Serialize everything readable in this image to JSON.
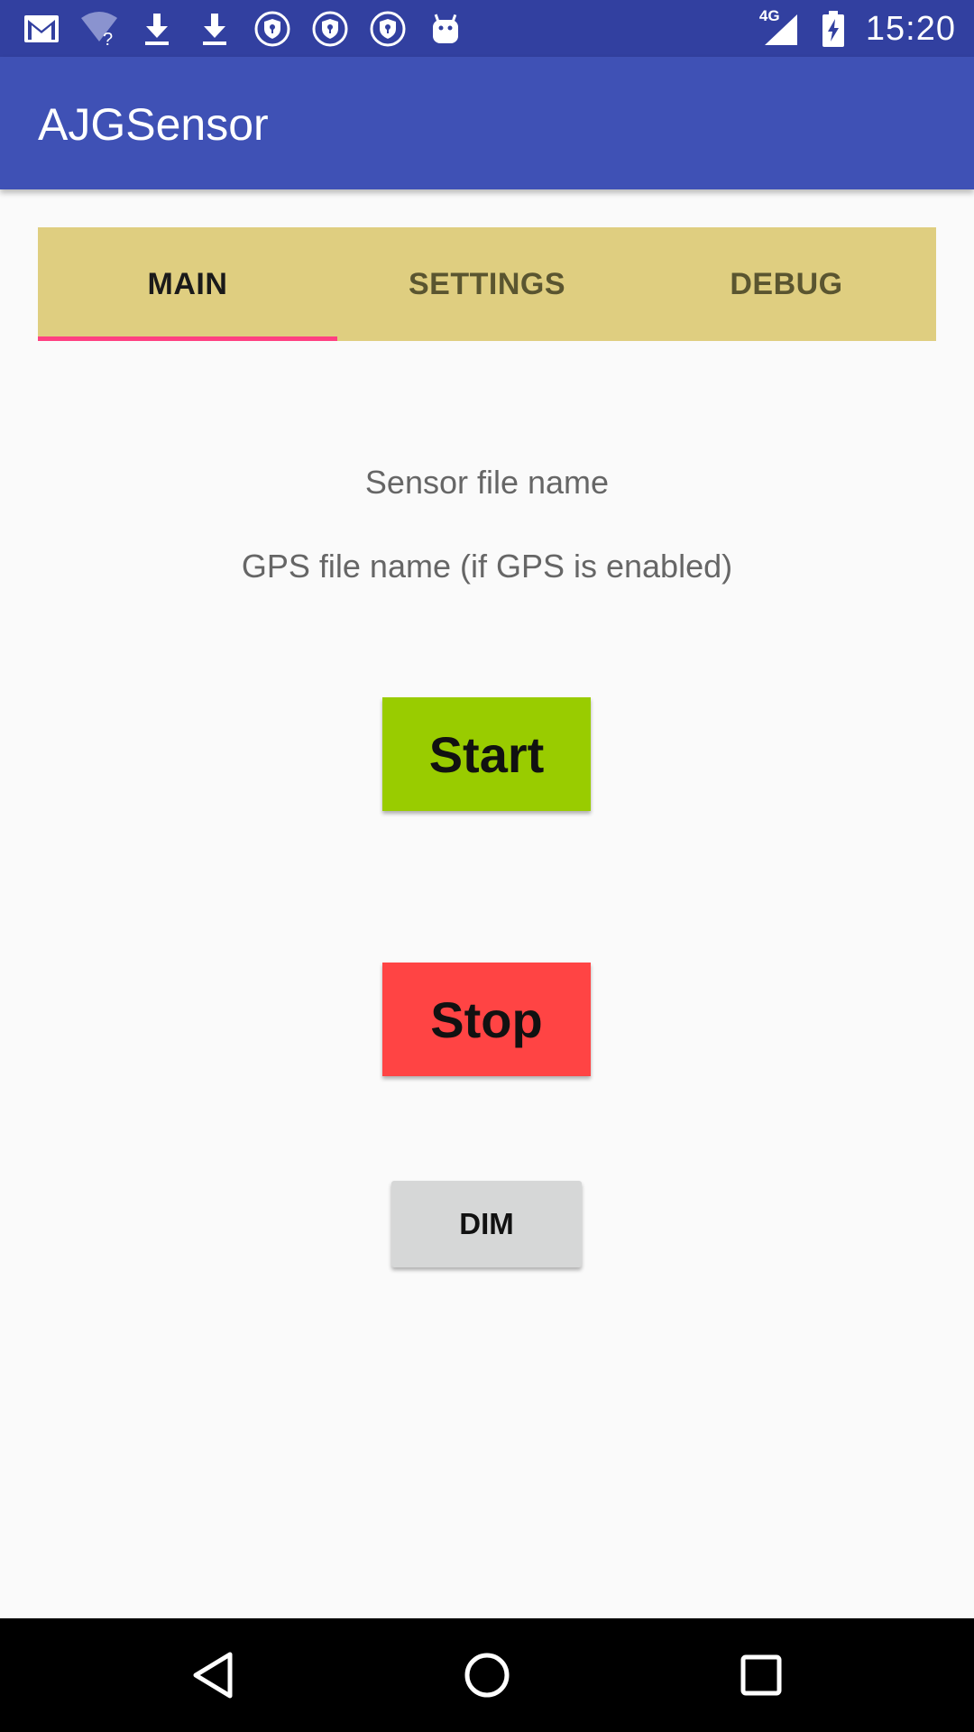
{
  "status_bar": {
    "time": "15:20",
    "network": "4G",
    "icons": [
      "gmail-icon",
      "wifi-question-icon",
      "download-icon",
      "download-icon",
      "vpn-shield-icon",
      "vpn-shield-icon",
      "vpn-shield-icon",
      "android-icon",
      "signal-icon",
      "battery-charging-icon"
    ]
  },
  "app_bar": {
    "title": "AJGSensor"
  },
  "tabs": [
    {
      "label": "MAIN",
      "active": true
    },
    {
      "label": "SETTINGS",
      "active": false
    },
    {
      "label": "DEBUG",
      "active": false
    }
  ],
  "main": {
    "sensor_file_label": "Sensor file name",
    "gps_file_label": "GPS file name (if GPS is enabled)",
    "start_label": "Start",
    "stop_label": "Stop",
    "dim_label": "DIM"
  },
  "colors": {
    "status_bar": "#3240a0",
    "app_bar": "#3f51b5",
    "tab_bar": "#dfce80",
    "tab_indicator": "#ff4081",
    "start_button": "#99cc00",
    "stop_button": "#ff4444",
    "dim_button": "#d6d7d7"
  },
  "nav_bar": {
    "icons": [
      "back-icon",
      "home-icon",
      "recents-icon"
    ]
  }
}
